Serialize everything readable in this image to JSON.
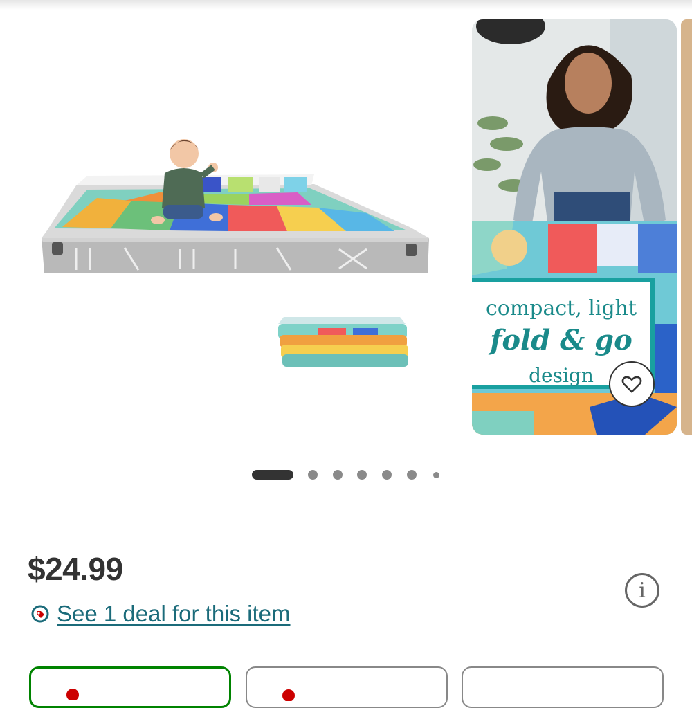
{
  "gallery": {
    "slide2_caption": {
      "line1": "compact, light",
      "line2": "fold & go",
      "line3": "design"
    },
    "dots_count": 7,
    "active_index": 0
  },
  "product": {
    "price": "$24.99",
    "deal_link": "See 1 deal for this item",
    "info_icon": "info-icon",
    "favorite_icon": "heart-icon",
    "deal_icon": "deal-tag-icon"
  },
  "variants": [
    {
      "selected": true
    },
    {
      "selected": false
    },
    {
      "selected": false
    }
  ],
  "colors": {
    "price": "#333333",
    "link": "#1b6b7a",
    "selected_variant_border": "#008300",
    "accent_red": "#cc0000",
    "teal": "#19a0a0"
  }
}
